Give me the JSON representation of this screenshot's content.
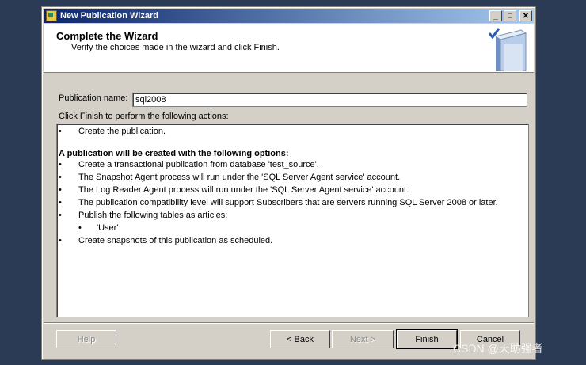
{
  "window": {
    "title": "New Publication Wizard",
    "min_glyph": "_",
    "max_glyph": "□",
    "close_glyph": "✕"
  },
  "header": {
    "title": "Complete the Wizard",
    "subtitle": "Verify the choices made in the wizard and click Finish.",
    "graphic_icon": "wizard-book-check-icon"
  },
  "form": {
    "publication_name_label": "Publication name:",
    "publication_name_value": "sql2008",
    "actions_label": "Click Finish to perform the following actions:"
  },
  "actions": {
    "bullet": "•",
    "items": [
      "Create the publication.",
      "A publication will be created with the following options:",
      "Create a transactional publication from database 'test_source'.",
      "The Snapshot Agent process will run under the 'SQL Server Agent service' account.",
      "The Log Reader Agent process will run under the 'SQL Server Agent service' account.",
      "The publication compatibility level will support Subscribers that are servers running SQL Server 2008 or later.",
      "Publish the following tables as articles:",
      "'User'",
      "Create snapshots of this publication as scheduled."
    ]
  },
  "buttons": {
    "help": "Help",
    "back": "< Back",
    "next": "Next >",
    "finish": "Finish",
    "cancel": "Cancel"
  },
  "watermark": "CSDN @天助强者",
  "colors": {
    "desktop": "#2b3a55",
    "titlebar_start": "#0a246a",
    "titlebar_end": "#a6caf0",
    "dialog_face": "#d4d0c8"
  }
}
